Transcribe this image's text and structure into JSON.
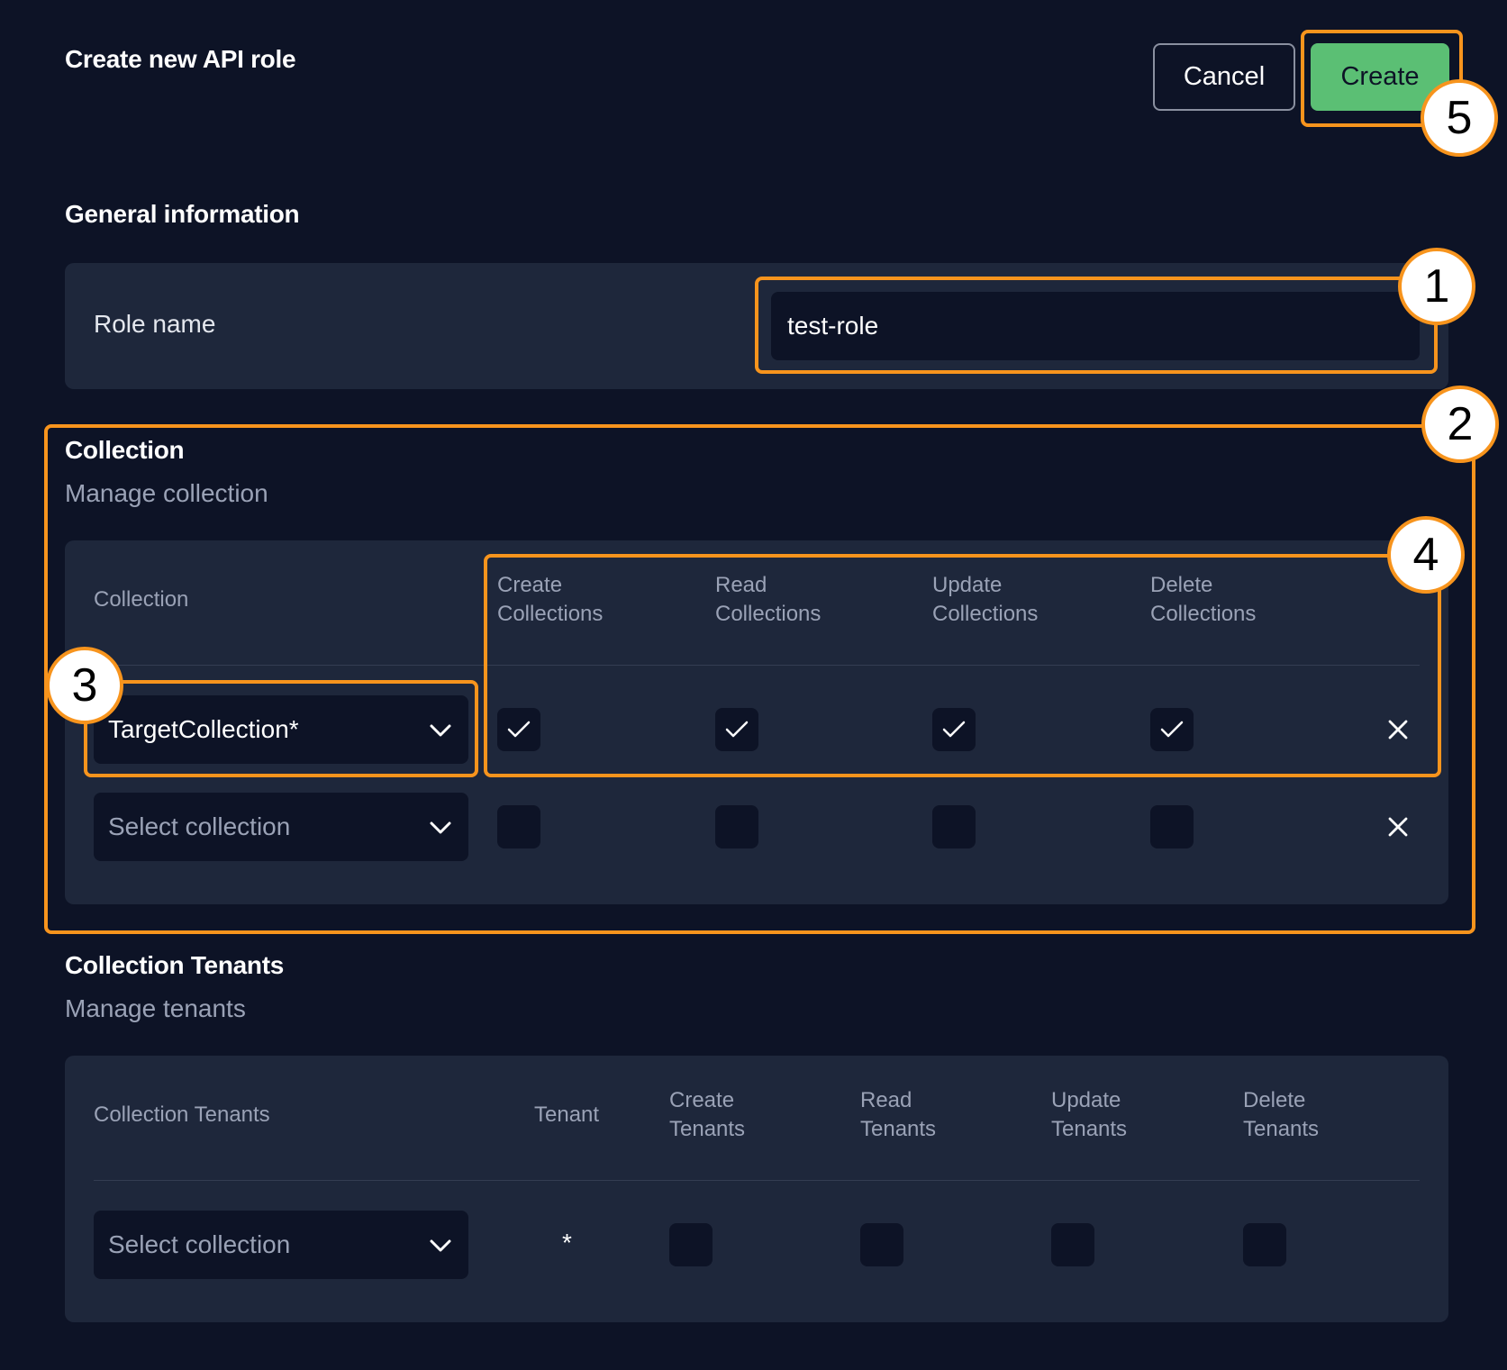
{
  "header": {
    "title": "Create new API role",
    "cancel_label": "Cancel",
    "create_label": "Create"
  },
  "general": {
    "title": "General information",
    "role_name_label": "Role name",
    "role_name_value": "test-role"
  },
  "collection": {
    "title": "Collection",
    "subtitle": "Manage collection",
    "headers": {
      "collection": "Collection",
      "create_1": "Create",
      "create_2": "Collections",
      "read_1": "Read",
      "read_2": "Collections",
      "update_1": "Update",
      "update_2": "Collections",
      "delete_1": "Delete",
      "delete_2": "Collections"
    },
    "rows": [
      {
        "value": "TargetCollection*",
        "create": true,
        "read": true,
        "update": true,
        "delete": true
      },
      {
        "placeholder": "Select collection",
        "create": false,
        "read": false,
        "update": false,
        "delete": false
      }
    ]
  },
  "tenants": {
    "title": "Collection Tenants",
    "subtitle": "Manage tenants",
    "headers": {
      "collection_tenants": "Collection Tenants",
      "tenant": "Tenant",
      "create_1": "Create",
      "create_2": "Tenants",
      "read_1": "Read",
      "read_2": "Tenants",
      "update_1": "Update",
      "update_2": "Tenants",
      "delete_1": "Delete",
      "delete_2": "Tenants"
    },
    "row": {
      "placeholder": "Select collection",
      "tenant": "*"
    }
  },
  "annotations": [
    "1",
    "2",
    "3",
    "4",
    "5"
  ],
  "colors": {
    "background": "#0d1326",
    "card": "#1e273b",
    "accent_green": "#5bbf74",
    "callout_orange": "#f7941d"
  }
}
